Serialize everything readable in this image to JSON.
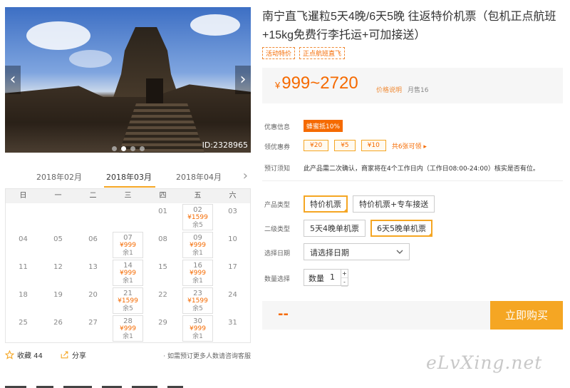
{
  "gallery": {
    "image_id": "ID:2328965",
    "prev": "‹",
    "next": "›",
    "dot_count": 4,
    "active_dot": 1
  },
  "calendar": {
    "months": [
      "2018年02月",
      "2018年03月",
      "2018年04月"
    ],
    "active_month": "2018年03月",
    "next": "›",
    "weekdays": [
      "日",
      "一",
      "二",
      "三",
      "四",
      "五",
      "六"
    ],
    "weeks": [
      [
        {
          "d": ""
        },
        {
          "d": ""
        },
        {
          "d": ""
        },
        {
          "d": ""
        },
        {
          "d": "01"
        },
        {
          "d": "02",
          "p": "¥1599",
          "r": "余5"
        },
        {
          "d": "03"
        }
      ],
      [
        {
          "d": "04"
        },
        {
          "d": "05"
        },
        {
          "d": "06"
        },
        {
          "d": "07",
          "p": "¥999",
          "r": "余1"
        },
        {
          "d": "08"
        },
        {
          "d": "09",
          "p": "¥999",
          "r": "余1"
        },
        {
          "d": "10"
        }
      ],
      [
        {
          "d": "11"
        },
        {
          "d": "12"
        },
        {
          "d": "13"
        },
        {
          "d": "14",
          "p": "¥999",
          "r": "余1"
        },
        {
          "d": "15"
        },
        {
          "d": "16",
          "p": "¥999",
          "r": "余1"
        },
        {
          "d": "17"
        }
      ],
      [
        {
          "d": "18"
        },
        {
          "d": "19"
        },
        {
          "d": "20"
        },
        {
          "d": "21",
          "p": "¥1599",
          "r": "余5"
        },
        {
          "d": "22"
        },
        {
          "d": "23",
          "p": "¥1599",
          "r": "余5"
        },
        {
          "d": "24"
        }
      ],
      [
        {
          "d": "25"
        },
        {
          "d": "26"
        },
        {
          "d": "27"
        },
        {
          "d": "28",
          "p": "¥999",
          "r": "余1"
        },
        {
          "d": "29"
        },
        {
          "d": "30",
          "p": "¥999",
          "r": "余1"
        },
        {
          "d": "31"
        }
      ]
    ]
  },
  "share_bar": {
    "fav_label": "收藏 44",
    "share_label": "分享",
    "consult": "如需预订更多人数请咨询客服"
  },
  "product": {
    "title": "南宁直飞暹粒5天4晚/6天5晚 往返特价机票（包机正点航班+15kg免费行李托运+可加接送）",
    "tags": [
      "活动特价",
      "正点航班直飞"
    ],
    "price_symbol": "¥",
    "price": "999~2720",
    "price_note": "价格说明",
    "sold": "月售16"
  },
  "info": {
    "discount_label": "优惠信息",
    "discount_badge": "蜂蜜抵10%",
    "coupon_label": "领优惠券",
    "coupons": [
      "¥20",
      "¥5",
      "¥10"
    ],
    "coupon_link": "共6张可领 ▸",
    "notice_label": "预订须知",
    "notice": "此产品需二次确认，商家将在4个工作日内（工作日08:00-24:00）核实是否有位。"
  },
  "options": {
    "type_label": "产品类型",
    "types": [
      "特价机票",
      "特价机票+专车接送"
    ],
    "selected_type": 0,
    "sub_label": "二级类型",
    "subs": [
      "5天4晚单机票",
      "6天5晚单机票"
    ],
    "selected_sub": 1,
    "date_label": "选择日期",
    "date_placeholder": "请选择日期",
    "qty_label": "数量选择",
    "qty_text": "数量",
    "qty_value": "1",
    "qty_plus": "+",
    "qty_minus": "-"
  },
  "buy": {
    "total": "--",
    "button": "立即购买"
  },
  "watermark": "eLvXing.net",
  "colors": {
    "accent": "#f5a623",
    "price": "#f56a00"
  }
}
